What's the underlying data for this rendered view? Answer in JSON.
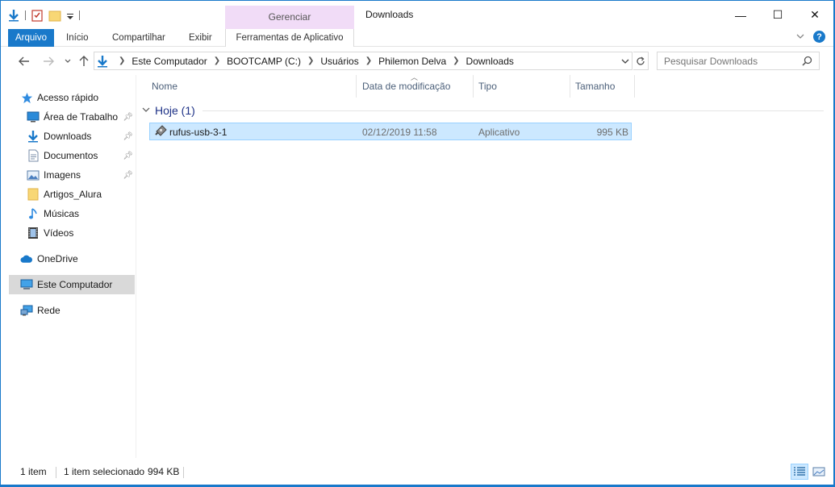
{
  "window": {
    "title": "Downloads",
    "controls": {
      "minimize": "—",
      "maximize": "☐",
      "close": "✕"
    }
  },
  "context_tab": {
    "label": "Gerenciar"
  },
  "ribbon": {
    "tabs": [
      "Arquivo",
      "Início",
      "Compartilhar",
      "Exibir"
    ],
    "manage_tab": "Ferramentas de Aplicativo",
    "accent": "#1979ca"
  },
  "address": {
    "crumbs": [
      "Este Computador",
      "BOOTCAMP (C:)",
      "Usuários",
      "Philemon Delva",
      "Downloads"
    ]
  },
  "search": {
    "placeholder": "Pesquisar Downloads"
  },
  "sidebar": {
    "items": [
      {
        "label": "Acesso rápido",
        "icon": "star-icon",
        "pinned": false
      },
      {
        "label": "Área de Trabalho",
        "icon": "desktop-icon",
        "pinned": true
      },
      {
        "label": "Downloads",
        "icon": "download-icon",
        "pinned": true
      },
      {
        "label": "Documentos",
        "icon": "document-icon",
        "pinned": true
      },
      {
        "label": "Imagens",
        "icon": "pictures-icon",
        "pinned": true
      },
      {
        "label": "Artigos_Alura",
        "icon": "folder-icon",
        "pinned": false
      },
      {
        "label": "Músicas",
        "icon": "music-icon",
        "pinned": false
      },
      {
        "label": "Vídeos",
        "icon": "video-icon",
        "pinned": false
      },
      {
        "label": "OneDrive",
        "icon": "cloud-icon",
        "pinned": false
      },
      {
        "label": "Este Computador",
        "icon": "computer-icon",
        "pinned": false,
        "selected": true
      },
      {
        "label": "Rede",
        "icon": "network-icon",
        "pinned": false
      }
    ]
  },
  "columns": [
    "Nome",
    "Data de modificação",
    "Tipo",
    "Tamanho"
  ],
  "group": {
    "label": "Hoje (1)"
  },
  "files": [
    {
      "name": "rufus-usb-3-1",
      "modified": "02/12/2019 11:58",
      "type": "Aplicativo",
      "size": "995 KB",
      "selected": true
    }
  ],
  "status": {
    "count": "1 item",
    "selection": "1 item selecionado",
    "selection_size": "994 KB"
  }
}
